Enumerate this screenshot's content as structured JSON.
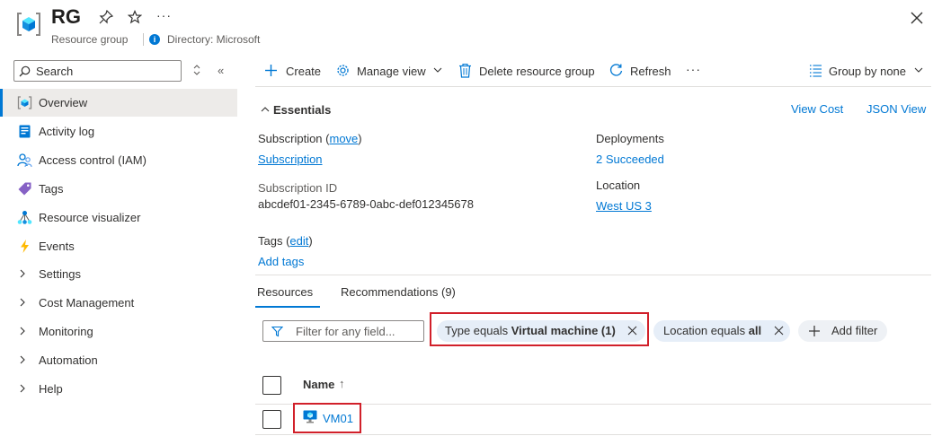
{
  "header": {
    "title": "RG",
    "subtitle": "Resource group",
    "directory": "Directory: Microsoft",
    "more": "···",
    "info_glyph": "i"
  },
  "sidebar": {
    "search_placeholder": "Search",
    "collapse_glyph": "«",
    "items": [
      {
        "label": "Overview",
        "icon": "resource-group-icon",
        "selected": true
      },
      {
        "label": "Activity log",
        "icon": "activity-log-icon"
      },
      {
        "label": "Access control (IAM)",
        "icon": "iam-icon"
      },
      {
        "label": "Tags",
        "icon": "tag-icon"
      },
      {
        "label": "Resource visualizer",
        "icon": "visualizer-icon"
      },
      {
        "label": "Events",
        "icon": "events-icon"
      },
      {
        "label": "Settings",
        "icon": "chevron-right-icon"
      },
      {
        "label": "Cost Management",
        "icon": "chevron-right-icon"
      },
      {
        "label": "Monitoring",
        "icon": "chevron-right-icon"
      },
      {
        "label": "Automation",
        "icon": "chevron-right-icon"
      },
      {
        "label": "Help",
        "icon": "chevron-right-icon"
      }
    ]
  },
  "toolbar": {
    "create": "Create",
    "manage_view": "Manage view",
    "delete": "Delete resource group",
    "refresh": "Refresh",
    "more": "···",
    "group_by": "Group by none"
  },
  "essentials": {
    "title": "Essentials",
    "view_cost": "View Cost",
    "json_view": "JSON View",
    "subscription_label": "Subscription",
    "move_link": "move",
    "subscription_value": "Subscription",
    "subscription_id_label": "Subscription ID",
    "subscription_id_value": "abcdef01-2345-6789-0abc-def012345678",
    "tags_label": "Tags",
    "edit_link": "edit",
    "add_tags": "Add tags",
    "deployments_label": "Deployments",
    "deployments_value": "2 Succeeded",
    "location_label": "Location",
    "location_value": "West US 3"
  },
  "tabs": {
    "resources": "Resources",
    "recommendations": "Recommendations (9)"
  },
  "filters": {
    "placeholder": "Filter for any field...",
    "type_prefix": "Type equals",
    "type_value": "Virtual machine (1)",
    "location_prefix": "Location equals",
    "location_value": "all",
    "add_filter": "Add filter"
  },
  "table": {
    "column_name": "Name",
    "sort_glyph": "↑",
    "rows": [
      {
        "name": "VM01",
        "icon": "virtual-machine-icon"
      }
    ]
  },
  "colors": {
    "accent": "#0078d4",
    "highlight": "#d1202a",
    "selected_bg": "#edebe9",
    "pill_bg": "#e6eef8"
  }
}
